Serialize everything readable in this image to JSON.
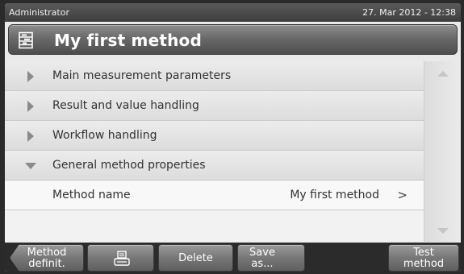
{
  "statusbar": {
    "user": "Administrator",
    "datetime": "27. Mar 2012 - 12:38"
  },
  "header": {
    "title": "My first method",
    "icon": "method-icon"
  },
  "sections": [
    {
      "label": "Main measurement parameters",
      "expanded": false
    },
    {
      "label": "Result and value handling",
      "expanded": false
    },
    {
      "label": "Workflow handling",
      "expanded": false
    },
    {
      "label": "General method properties",
      "expanded": true
    }
  ],
  "items": [
    {
      "label": "Method name",
      "value": "My first method",
      "chevron": ">"
    }
  ],
  "footer": {
    "back_line1": "Method",
    "back_line2": "definit.",
    "print_icon": "printer-icon",
    "delete_label": "Delete",
    "save_line1": "Save",
    "save_line2": "as...",
    "test_line1": "Test",
    "test_line2": "method"
  }
}
